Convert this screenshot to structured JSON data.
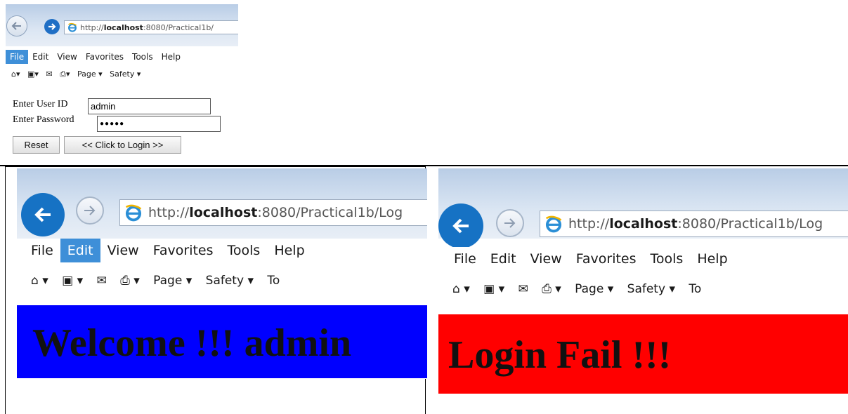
{
  "panel1": {
    "address_url_prefix": "http://",
    "address_url_host": "localhost",
    "address_url_rest": ":8080/Practical1b/",
    "menu": [
      "File",
      "Edit",
      "View",
      "Favorites",
      "Tools",
      "Help"
    ],
    "active_menu": "File",
    "toolbar": {
      "page": "Page ▾",
      "safety": "Safety ▾"
    },
    "form": {
      "user_label": "Enter User ID",
      "user_value": "admin",
      "password_label": "Enter Password",
      "password_value": "●●●●●",
      "reset_label": "Reset",
      "login_label": "<< Click to Login >>"
    }
  },
  "panel2": {
    "address_url_prefix": "http://",
    "address_url_host": "localhost",
    "address_url_rest": ":8080/Practical1b/Log",
    "menu": [
      "File",
      "Edit",
      "View",
      "Favorites",
      "Tools",
      "Help"
    ],
    "active_menu": "Edit",
    "toolbar": {
      "page": "Page ▾",
      "safety": "Safety ▾",
      "tools": "To"
    },
    "banner_text": "Welcome !!! admin",
    "banner_color": "#0000ff"
  },
  "panel3": {
    "address_url_prefix": "http://",
    "address_url_host": "localhost",
    "address_url_rest": ":8080/Practical1b/Log",
    "menu": [
      "File",
      "Edit",
      "View",
      "Favorites",
      "Tools",
      "Help"
    ],
    "active_menu": "",
    "toolbar": {
      "page": "Page ▾",
      "safety": "Safety ▾",
      "tools": "To"
    },
    "banner_text": "Login Fail !!!",
    "banner_color": "#ff0000"
  },
  "icons": [
    "back-arrow-icon",
    "forward-arrow-icon",
    "ie-logo-icon",
    "home-icon",
    "rss-feed-icon",
    "mail-icon",
    "print-icon"
  ]
}
